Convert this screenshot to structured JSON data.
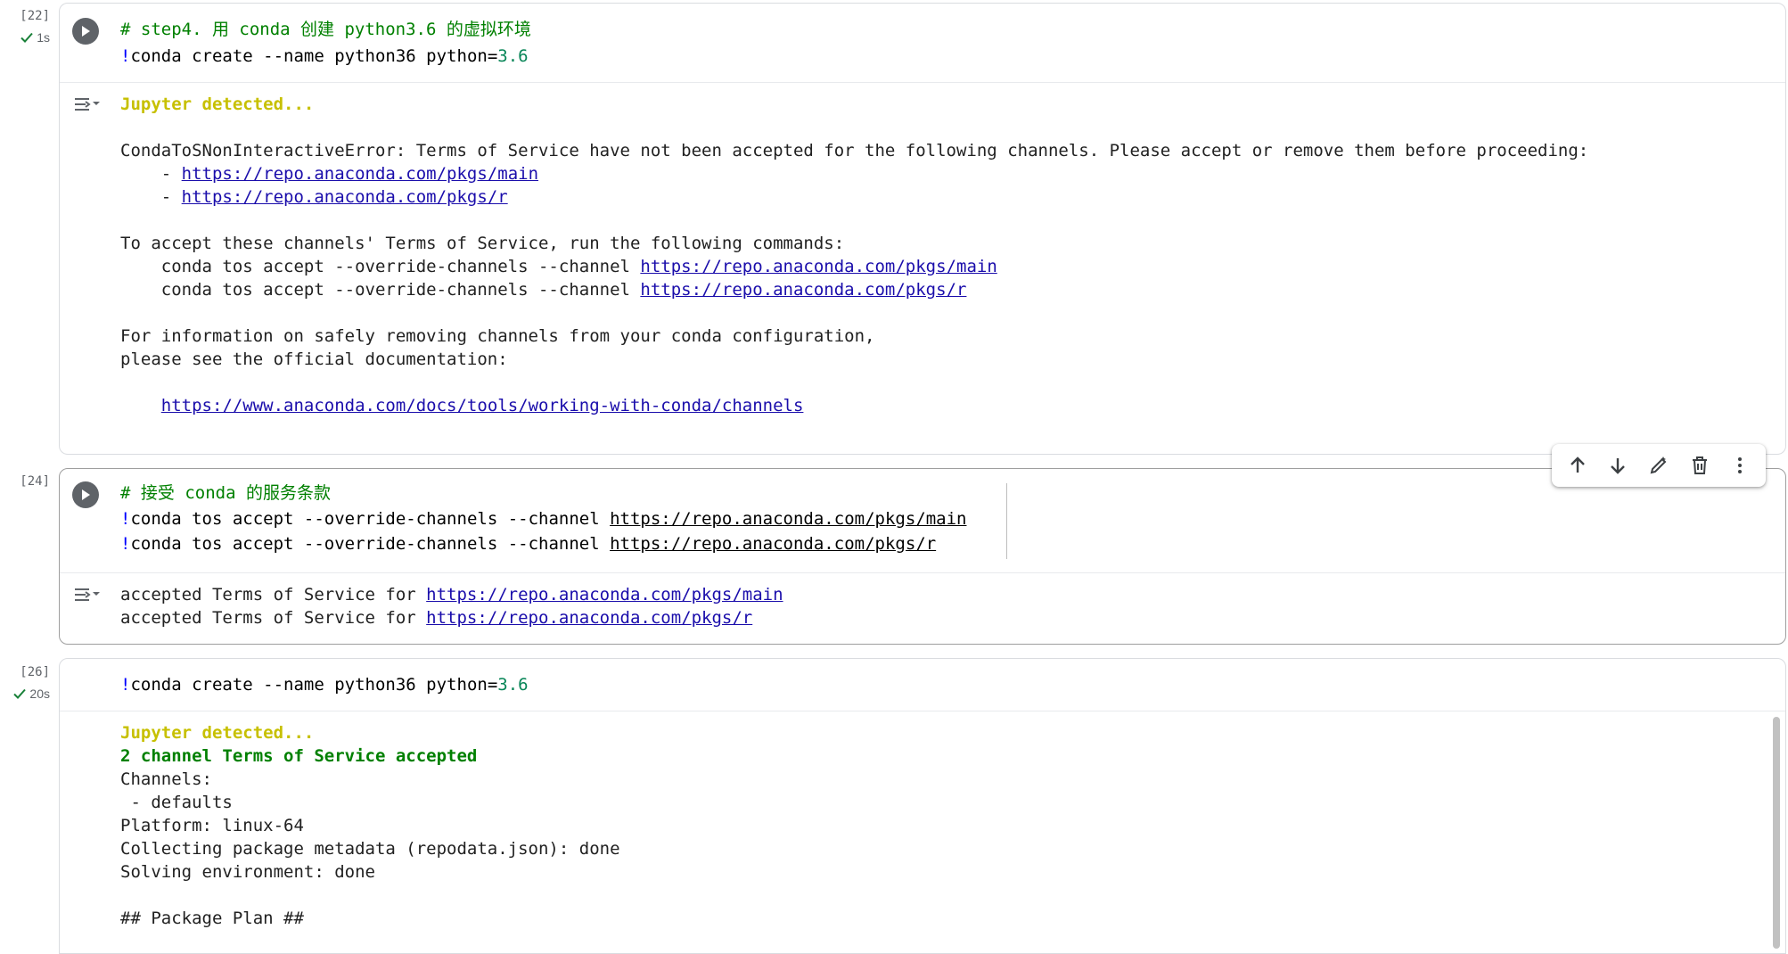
{
  "cells": [
    {
      "exec_count": "[22]",
      "duration": "1s",
      "code": {
        "line1_comment": "# step4. 用 conda 创建 python3.6 的虚拟环境",
        "line2_bang": "!",
        "line2_main": "conda create --name python36 python=",
        "line2_num": "3.6"
      },
      "output": {
        "jupyter": "Jupyter detected...",
        "error_line": "CondaToSNonInteractiveError: Terms of Service have not been accepted for the following channels. Please accept or remove them before proceeding:",
        "bullet_prefix": "    - ",
        "channel_main": "https://repo.anaconda.com/pkgs/main",
        "channel_r": "https://repo.anaconda.com/pkgs/r",
        "accept_intro": "To accept these channels' Terms of Service, run the following commands:",
        "cmd_prefix": "    conda tos accept --override-channels --channel ",
        "info1": "For information on safely removing channels from your conda configuration,",
        "info2": "please see the official documentation:",
        "doc_link": "https://www.anaconda.com/docs/tools/working-with-conda/channels"
      }
    },
    {
      "exec_count": "[24]",
      "code": {
        "line1_comment": "# 接受 conda 的服务条款",
        "bang": "!",
        "cmd": "conda tos accept --override-channels --channel ",
        "url_main": "https://repo.anaconda.com/pkgs/main",
        "url_r": "https://repo.anaconda.com/pkgs/r"
      },
      "output": {
        "prefix": "accepted Terms of Service for ",
        "url_main": "https://repo.anaconda.com/pkgs/main",
        "url_r": "https://repo.anaconda.com/pkgs/r"
      }
    },
    {
      "exec_count": "[26]",
      "duration": "20s",
      "code": {
        "bang": "!",
        "main": "conda create --name python36 python=",
        "num": "3.6"
      },
      "output": {
        "jupyter": "Jupyter detected...",
        "accepted": "2 channel Terms of Service accepted",
        "l1": "Channels:",
        "l2": " - defaults",
        "l3": "Platform: linux-64",
        "l4": "Collecting package metadata (repodata.json): done",
        "l5": "Solving environment: done",
        "l6": "## Package Plan ##"
      }
    }
  ],
  "toolbar": {
    "icons": [
      "arrow-up-icon",
      "arrow-down-icon",
      "edit-pen-icon",
      "trash-icon",
      "more-vert-icon"
    ]
  },
  "colors": {
    "comment": "#008000",
    "keyword_bang": "#0000ff",
    "number": "#098658",
    "jupyter_yellow": "#c7c000",
    "link": "#1a0dab"
  }
}
